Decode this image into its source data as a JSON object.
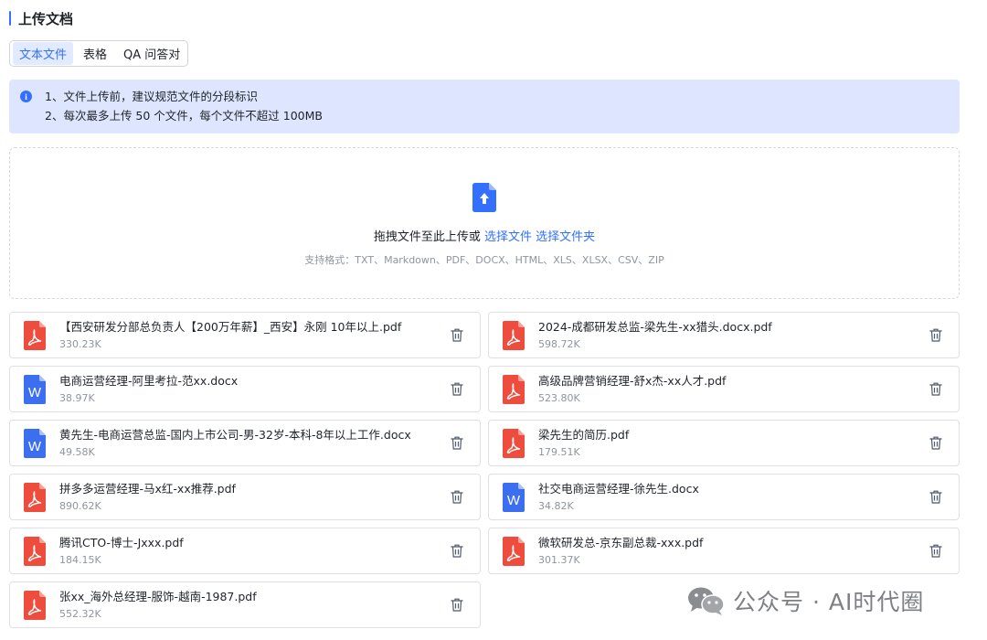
{
  "section": {
    "title": "上传文档"
  },
  "tabs": [
    {
      "label": "文本文件",
      "active": true
    },
    {
      "label": "表格",
      "active": false
    },
    {
      "label": "QA 问答对",
      "active": false
    }
  ],
  "notice": {
    "icon": "info-icon",
    "lines": [
      "1、文件上传前，建议规范文件的分段标识",
      "2、每次最多上传 50 个文件，每个文件不超过 100MB"
    ]
  },
  "dropzone": {
    "icon": "upload-file-icon",
    "prompt": "拖拽文件至此上传或",
    "select_file": "选择文件",
    "select_folder": "选择文件夹",
    "formats": "支持格式：TXT、Markdown、PDF、DOCX、HTML、XLS、XLSX、CSV、ZIP"
  },
  "files": [
    {
      "name": "【西安研发分部总负责人【200万年薪】_西安】永刚 10年以上.pdf",
      "size": "330.23K",
      "type": "pdf"
    },
    {
      "name": "2024-成都研发总监-梁先生-xx猎头.docx.pdf",
      "size": "598.72K",
      "type": "pdf"
    },
    {
      "name": "电商运营经理-阿里考拉-范xx.docx",
      "size": "38.97K",
      "type": "docx"
    },
    {
      "name": "高级品牌营销经理-舒x杰-xx人才.pdf",
      "size": "523.80K",
      "type": "pdf"
    },
    {
      "name": "黄先生-电商运营总监-国内上市公司-男-32岁-本科-8年以上工作.docx",
      "size": "49.58K",
      "type": "docx"
    },
    {
      "name": "梁先生的简历.pdf",
      "size": "179.51K",
      "type": "pdf"
    },
    {
      "name": "拼多多运营经理-马x红-xx推荐.pdf",
      "size": "890.62K",
      "type": "pdf"
    },
    {
      "name": "社交电商运营经理-徐先生.docx",
      "size": "34.82K",
      "type": "docx"
    },
    {
      "name": "腾讯CTO-博士-Jxxx.pdf",
      "size": "184.15K",
      "type": "pdf"
    },
    {
      "name": "微软研发总-京东副总裁-xxx.pdf",
      "size": "301.37K",
      "type": "pdf"
    },
    {
      "name": "张xx_海外总经理-服饰-越南-1987.pdf",
      "size": "552.32K",
      "type": "pdf"
    }
  ],
  "watermark": {
    "text": "公众号 · AI时代圈",
    "icon": "wechat-icon"
  },
  "colors": {
    "accent": "#3370ff",
    "pdf": "#ee4d3e",
    "docx": "#3b6ff0",
    "notice_bg": "#dde6fe"
  }
}
